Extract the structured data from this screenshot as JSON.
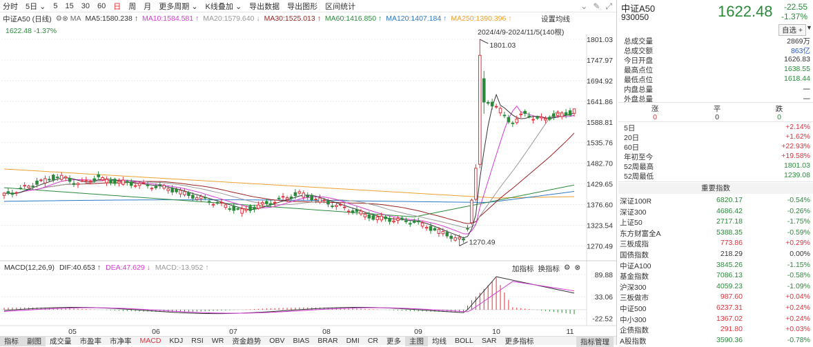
{
  "toolbar": {
    "items": [
      "分时",
      "5日",
      "5",
      "15",
      "30",
      "60",
      "日",
      "周",
      "月",
      "更多周期",
      "K线叠加",
      "导出数据",
      "导出图形",
      "区间统计"
    ],
    "active_index": 6
  },
  "ma_legend": {
    "title": "中证A50 (日线)",
    "ma_label": "MA",
    "items": [
      {
        "text": "MA5:1580.238",
        "arrow": "↑",
        "color": "#333333"
      },
      {
        "text": "MA10:1584.581",
        "arrow": "↑",
        "color": "#d63ad6"
      },
      {
        "text": "MA20:1579.640",
        "arrow": "↓",
        "color": "#999999"
      },
      {
        "text": "MA30:1525.013",
        "arrow": "↑",
        "color": "#9a1f1f"
      },
      {
        "text": "MA60:1416.850",
        "arrow": "↑",
        "color": "#2a8a3a"
      },
      {
        "text": "MA120:1407.184",
        "arrow": "↑",
        "color": "#2b78c8"
      },
      {
        "text": "MA250:1390.396",
        "arrow": "↑",
        "color": "#f0a030"
      }
    ],
    "settings": "设置均线",
    "price_line": "1622.48  -1.37%",
    "date_range": "2024/4/9-2024/11/5(140根)"
  },
  "chart_data": {
    "type": "candlestick",
    "ylim": [
      1250,
      1810
    ],
    "yticks": [
      "1801.03",
      "1747.97",
      "1694.92",
      "1641.86",
      "1588.81",
      "1535.76",
      "1482.70",
      "1429.65",
      "1376.60",
      "1323.54",
      "1270.49"
    ],
    "xticks": [
      "05",
      "06",
      "07",
      "08",
      "09",
      "10",
      "11"
    ],
    "high_label": "1801.03",
    "low_label": "1270.49",
    "colors": {
      "up": "#e0303a",
      "down": "#2a8a3a"
    },
    "macd": {
      "title": "MACD(12,26,9)",
      "dif": "DIF:40.653",
      "dif_arrow": "↑",
      "dea": "DEA:47.629",
      "dea_arrow": "↓",
      "macd": "MACD:-13.952",
      "macd_arrow": "↑",
      "yticks": [
        "89.88",
        "33.06",
        "-22.52"
      ],
      "ylim": [
        -30,
        100
      ]
    }
  },
  "macd_tools": {
    "add": "加指标",
    "swap": "换指标"
  },
  "bottom_tabs": {
    "items": [
      "指标",
      "副图",
      "成交量",
      "市盈率",
      "市净率",
      "MACD",
      "KDJ",
      "RSI",
      "WR",
      "资金趋势",
      "OBV",
      "BIAS",
      "BRAR",
      "DMI",
      "CR",
      "更多",
      "主图",
      "均线",
      "BOLL",
      "SAR",
      "更多指标"
    ],
    "boxed": [
      0,
      1,
      16
    ],
    "active": 5,
    "manage": "指标管理"
  },
  "panel": {
    "name": "中证A50",
    "code": "930050",
    "price": "1622.48",
    "change": "-22.55",
    "change_pct": "-1.37%",
    "fav": "自选 +",
    "stats": [
      {
        "label": "总成交量",
        "value": "2869万",
        "cls": "gray"
      },
      {
        "label": "总成交额",
        "value": "863亿",
        "cls": "blue"
      },
      {
        "label": "今日开盘",
        "value": "1626.83",
        "cls": "gray"
      },
      {
        "label": "最高点位",
        "value": "1638.55",
        "cls": "green"
      },
      {
        "label": "最低点位",
        "value": "1618.44",
        "cls": "green"
      },
      {
        "label": "内盘总量",
        "value": "一",
        "cls": "gray"
      },
      {
        "label": "外盘总量",
        "value": "一",
        "cls": "gray"
      }
    ],
    "breadth_labels": [
      "涨",
      "平",
      "跌"
    ],
    "breadth_values": [
      "0",
      "0",
      "0"
    ],
    "periods": [
      {
        "label": "5日",
        "value": "+2.14%",
        "cls": "red"
      },
      {
        "label": "20日",
        "value": "+1.62%",
        "cls": "red"
      },
      {
        "label": "60日",
        "value": "+22.93%",
        "cls": "red"
      },
      {
        "label": "年初至今",
        "value": "+19.58%",
        "cls": "red"
      },
      {
        "label": "52周最高",
        "value": "1801.03",
        "cls": "green"
      },
      {
        "label": "52周最低",
        "value": "1239.08",
        "cls": "green"
      }
    ],
    "indices_title": "重要指数",
    "indices": [
      {
        "name": "深证100R",
        "price": "6820.17",
        "chg": "-0.54%",
        "cls": "green"
      },
      {
        "name": "深证300",
        "price": "4686.42",
        "chg": "-0.26%",
        "cls": "green"
      },
      {
        "name": "上证50",
        "price": "2717.18",
        "chg": "-1.75%",
        "cls": "green"
      },
      {
        "name": "东方财富全A",
        "price": "5388.35",
        "chg": "-0.59%",
        "cls": "green"
      },
      {
        "name": "三板成指",
        "price": "773.86",
        "chg": "+0.29%",
        "cls": "red"
      },
      {
        "name": "国债指数",
        "price": "218.29",
        "chg": "0.00%",
        "cls": "gray"
      },
      {
        "name": "中证A100",
        "price": "3845.26",
        "chg": "-1.15%",
        "cls": "green"
      },
      {
        "name": "基金指数",
        "price": "7086.13",
        "chg": "-0.58%",
        "cls": "green"
      },
      {
        "name": "沪深300",
        "price": "4059.23",
        "chg": "-1.09%",
        "cls": "green"
      },
      {
        "name": "三板做市",
        "price": "987.60",
        "chg": "+0.04%",
        "cls": "red"
      },
      {
        "name": "中证500",
        "price": "6237.31",
        "chg": "+0.24%",
        "cls": "red"
      },
      {
        "name": "中小300",
        "price": "1367.02",
        "chg": "+0.24%",
        "cls": "red"
      },
      {
        "name": "企债指数",
        "price": "291.80",
        "chg": "+0.03%",
        "cls": "red"
      },
      {
        "name": "A股指数",
        "price": "3590.36",
        "chg": "-0.78%",
        "cls": "green"
      }
    ]
  }
}
